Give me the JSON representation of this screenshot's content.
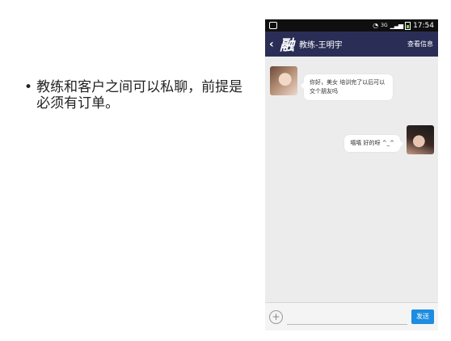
{
  "slide": {
    "bullet": "•",
    "text": "教练和客户之间可以私聊，前提是必须有订单。"
  },
  "status_bar": {
    "notification_icon": "notification-icon",
    "wifi_icon": "wifi-icon",
    "network": "3G",
    "signal_icon": "signal-icon",
    "battery_icon": "battery-icon",
    "time": "17:54"
  },
  "nav": {
    "back_icon": "‹",
    "logo": "融",
    "title": "教练-王明宇",
    "action": "查看信息"
  },
  "messages": [
    {
      "side": "left",
      "text": "你好，美女 培训完了以后可以交个朋友吗"
    },
    {
      "side": "right",
      "text": "嘻嘻 好的呀 ^_^"
    }
  ],
  "input": {
    "add_icon": "+",
    "value": "",
    "send_label": "发送"
  },
  "colors": {
    "nav_bg": "#2a2e56",
    "chat_bg": "#ececec",
    "send_button": "#1c8de0"
  }
}
